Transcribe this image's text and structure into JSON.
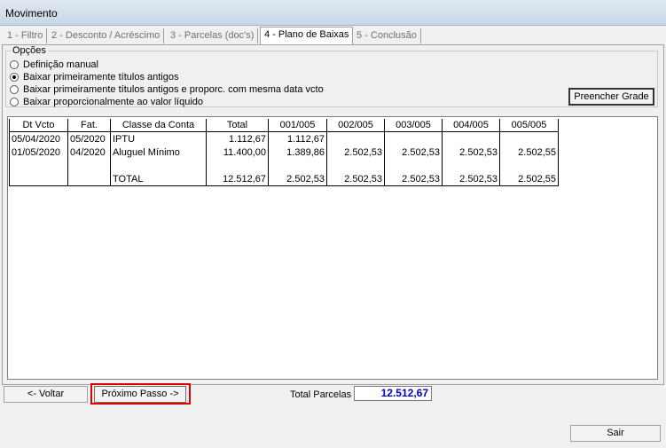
{
  "window": {
    "title": "Movimento"
  },
  "tabs": [
    {
      "label": "1 - Filtro",
      "active": false
    },
    {
      "label": "2 - Desconto / Acréscimo",
      "active": false
    },
    {
      "label": "3 - Parcelas (doc's)",
      "active": false
    },
    {
      "label": "4 - Plano de Baixas",
      "active": true
    },
    {
      "label": "5 - Conclusão",
      "active": false
    }
  ],
  "options": {
    "group_label": "Opções",
    "items": [
      {
        "label": "Definição manual",
        "selected": false
      },
      {
        "label": "Baixar primeiramente títulos antigos",
        "selected": true
      },
      {
        "label": "Baixar primeiramente títulos antigos e proporc. com mesma data vcto",
        "selected": false
      },
      {
        "label": "Baixar proporcionalmente ao valor líquido",
        "selected": false
      }
    ]
  },
  "buttons": {
    "fill_grid": "Preencher Grade",
    "back": "<- Voltar",
    "next": "Próximo Passo ->",
    "exit": "Sair"
  },
  "grid": {
    "columns": [
      "Dt Vcto",
      "Fat.",
      "Classe da Conta",
      "Total",
      "001/005",
      "002/005",
      "003/005",
      "004/005",
      "005/005"
    ],
    "rows": [
      [
        "05/04/2020",
        "05/2020",
        "IPTU",
        "1.112,67",
        "1.112,67",
        "",
        "",
        "",
        ""
      ],
      [
        "01/05/2020",
        "04/2020",
        "Aluguel Mínimo",
        "11.400,00",
        "1.389,86",
        "2.502,53",
        "2.502,53",
        "2.502,53",
        "2.502,55"
      ],
      [
        "",
        "",
        "",
        "",
        "",
        "",
        "",
        "",
        ""
      ],
      [
        "",
        "",
        "TOTAL",
        "12.512,67",
        "2.502,53",
        "2.502,53",
        "2.502,53",
        "2.502,53",
        "2.502,55"
      ]
    ]
  },
  "footer": {
    "total_label": "Total Parcelas",
    "total_value": "12.512,67"
  },
  "colors": {
    "highlight": "#e00000",
    "total_value": "#0000c0"
  }
}
